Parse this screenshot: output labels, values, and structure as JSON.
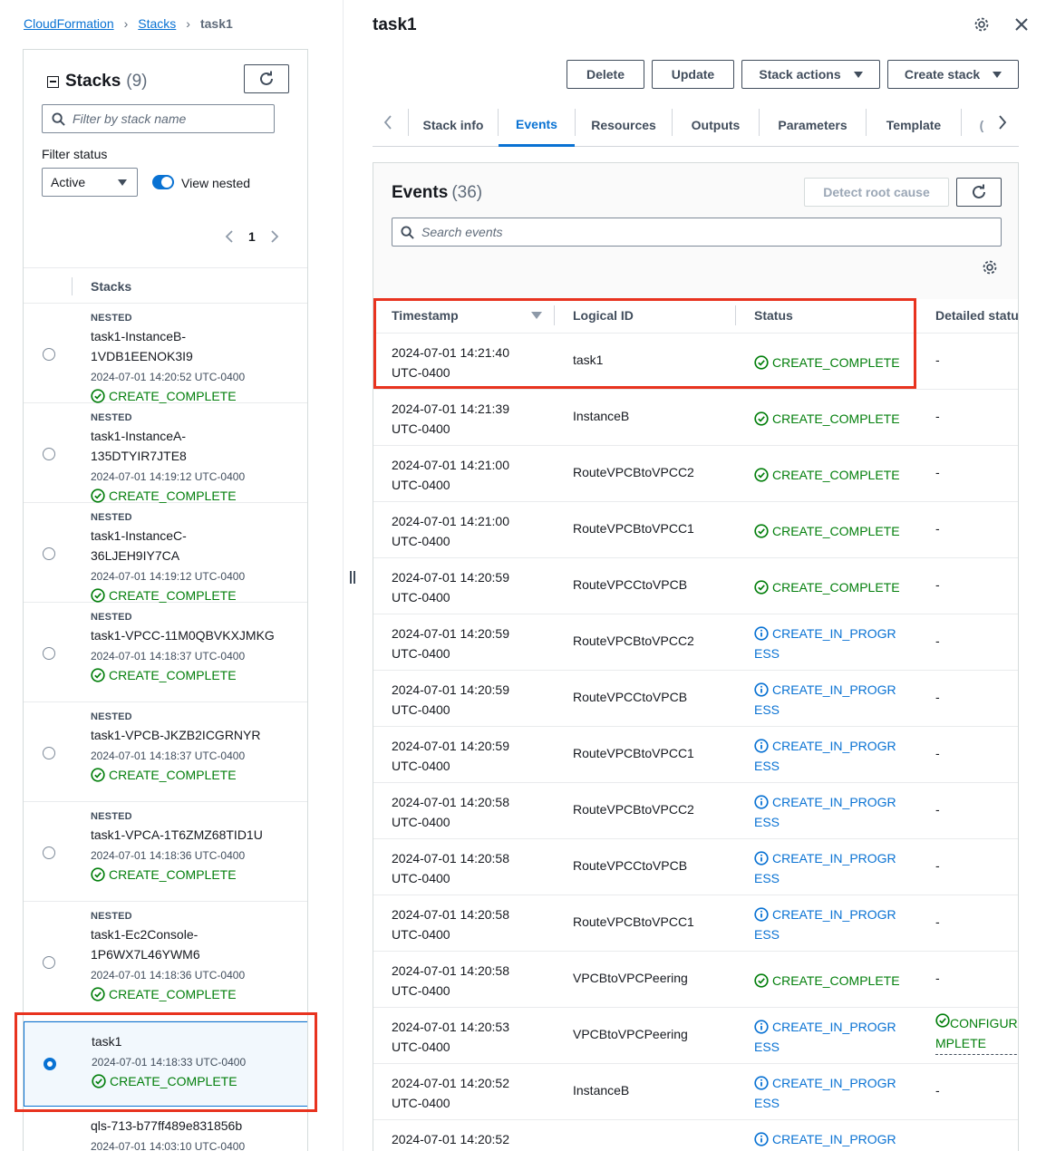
{
  "breadcrumb": {
    "root": "CloudFormation",
    "section": "Stacks",
    "current": "task1"
  },
  "stacks_panel": {
    "title": "Stacks",
    "count": "(9)",
    "filter_placeholder": "Filter by stack name",
    "filter_status_label": "Filter status",
    "filter_status_value": "Active",
    "view_nested_label": "View nested",
    "page": "1",
    "column_header": "Stacks",
    "items": [
      {
        "tag": "NESTED",
        "name": "task1-InstanceB-1VDB1EENOK3I9",
        "date": "2024-07-01 14:20:52 UTC-0400",
        "status": "CREATE_COMPLETE"
      },
      {
        "tag": "NESTED",
        "name": "task1-InstanceA-135DTYIR7JTE8",
        "date": "2024-07-01 14:19:12 UTC-0400",
        "status": "CREATE_COMPLETE"
      },
      {
        "tag": "NESTED",
        "name": "task1-InstanceC-36LJEH9IY7CA",
        "date": "2024-07-01 14:19:12 UTC-0400",
        "status": "CREATE_COMPLETE"
      },
      {
        "tag": "NESTED",
        "name": "task1-VPCC-11M0QBVKXJMKG",
        "date": "2024-07-01 14:18:37 UTC-0400",
        "status": "CREATE_COMPLETE"
      },
      {
        "tag": "NESTED",
        "name": "task1-VPCB-JKZB2ICGRNYR",
        "date": "2024-07-01 14:18:37 UTC-0400",
        "status": "CREATE_COMPLETE"
      },
      {
        "tag": "NESTED",
        "name": "task1-VPCA-1T6ZMZ68TID1U",
        "date": "2024-07-01 14:18:36 UTC-0400",
        "status": "CREATE_COMPLETE"
      },
      {
        "tag": "NESTED",
        "name": "task1-Ec2Console-1P6WX7L46YWM6",
        "date": "2024-07-01 14:18:36 UTC-0400",
        "status": "CREATE_COMPLETE"
      },
      {
        "tag": "",
        "name": "task1",
        "date": "2024-07-01 14:18:33 UTC-0400",
        "status": "CREATE_COMPLETE"
      },
      {
        "tag": "",
        "name": "qls-713-b77ff489e831856b",
        "date": "2024-07-01 14:03:10 UTC-0400",
        "status": ""
      }
    ]
  },
  "main": {
    "title": "task1",
    "buttons": {
      "delete": "Delete",
      "update": "Update",
      "stack_actions": "Stack actions",
      "create_stack": "Create stack"
    },
    "tabs": [
      "Stack info",
      "Events",
      "Resources",
      "Outputs",
      "Parameters",
      "Template"
    ],
    "active_tab": "Events",
    "events": {
      "title": "Events",
      "count": "(36)",
      "detect_button": "Detect root cause",
      "search_placeholder": "Search events",
      "columns": {
        "timestamp": "Timestamp",
        "logical_id": "Logical ID",
        "status": "Status",
        "detailed_status": "Detailed statu"
      },
      "rows": [
        {
          "ts1": "2024-07-01 14:21:40",
          "ts2": "UTC-0400",
          "logical_id": "task1",
          "status": "CREATE_COMPLETE",
          "kind": "complete",
          "detail": "-"
        },
        {
          "ts1": "2024-07-01 14:21:39",
          "ts2": "UTC-0400",
          "logical_id": "InstanceB",
          "status": "CREATE_COMPLETE",
          "kind": "complete",
          "detail": "-"
        },
        {
          "ts1": "2024-07-01 14:21:00",
          "ts2": "UTC-0400",
          "logical_id": "RouteVPCBtoVPCC2",
          "status": "CREATE_COMPLETE",
          "kind": "complete",
          "detail": "-"
        },
        {
          "ts1": "2024-07-01 14:21:00",
          "ts2": "UTC-0400",
          "logical_id": "RouteVPCBtoVPCC1",
          "status": "CREATE_COMPLETE",
          "kind": "complete",
          "detail": "-"
        },
        {
          "ts1": "2024-07-01 14:20:59",
          "ts2": "UTC-0400",
          "logical_id": "RouteVPCCtoVPCB",
          "status": "CREATE_COMPLETE",
          "kind": "complete",
          "detail": "-"
        },
        {
          "ts1": "2024-07-01 14:20:59",
          "ts2": "UTC-0400",
          "logical_id": "RouteVPCBtoVPCC2",
          "status": "CREATE_IN_PROGRESS",
          "kind": "progress",
          "detail": "-"
        },
        {
          "ts1": "2024-07-01 14:20:59",
          "ts2": "UTC-0400",
          "logical_id": "RouteVPCCtoVPCB",
          "status": "CREATE_IN_PROGRESS",
          "kind": "progress",
          "detail": "-"
        },
        {
          "ts1": "2024-07-01 14:20:59",
          "ts2": "UTC-0400",
          "logical_id": "RouteVPCBtoVPCC1",
          "status": "CREATE_IN_PROGRESS",
          "kind": "progress",
          "detail": "-"
        },
        {
          "ts1": "2024-07-01 14:20:58",
          "ts2": "UTC-0400",
          "logical_id": "RouteVPCBtoVPCC2",
          "status": "CREATE_IN_PROGRESS",
          "kind": "progress",
          "detail": "-"
        },
        {
          "ts1": "2024-07-01 14:20:58",
          "ts2": "UTC-0400",
          "logical_id": "RouteVPCCtoVPCB",
          "status": "CREATE_IN_PROGRESS",
          "kind": "progress",
          "detail": "-"
        },
        {
          "ts1": "2024-07-01 14:20:58",
          "ts2": "UTC-0400",
          "logical_id": "RouteVPCBtoVPCC1",
          "status": "CREATE_IN_PROGRESS",
          "kind": "progress",
          "detail": "-"
        },
        {
          "ts1": "2024-07-01 14:20:58",
          "ts2": "UTC-0400",
          "logical_id": "VPCBtoVPCPeering",
          "status": "CREATE_COMPLETE",
          "kind": "complete",
          "detail": "-"
        },
        {
          "ts1": "2024-07-01 14:20:53",
          "ts2": "UTC-0400",
          "logical_id": "VPCBtoVPCPeering",
          "status": "CREATE_IN_PROGRESS",
          "kind": "progress",
          "detail": "CONFIGURA MPLETE",
          "detail_kind": "config"
        },
        {
          "ts1": "2024-07-01 14:20:52",
          "ts2": "UTC-0400",
          "logical_id": "InstanceB",
          "status": "CREATE_IN_PROGRESS",
          "kind": "progress",
          "detail": "-"
        },
        {
          "ts1": "2024-07-01 14:20:52",
          "ts2": "",
          "logical_id": "",
          "status": "CREATE_IN_PROGRES",
          "kind": "progress",
          "detail": ""
        }
      ]
    }
  },
  "colors": {
    "link": "#0972d3",
    "success": "#037f0c",
    "highlight": "#e8331f",
    "text": "#16191f"
  },
  "icons": [
    "refresh-icon",
    "search-icon",
    "gear-icon",
    "close-icon",
    "check-circle-icon",
    "info-circle-icon",
    "chevron-left-icon",
    "chevron-right-icon",
    "caret-down-icon"
  ]
}
